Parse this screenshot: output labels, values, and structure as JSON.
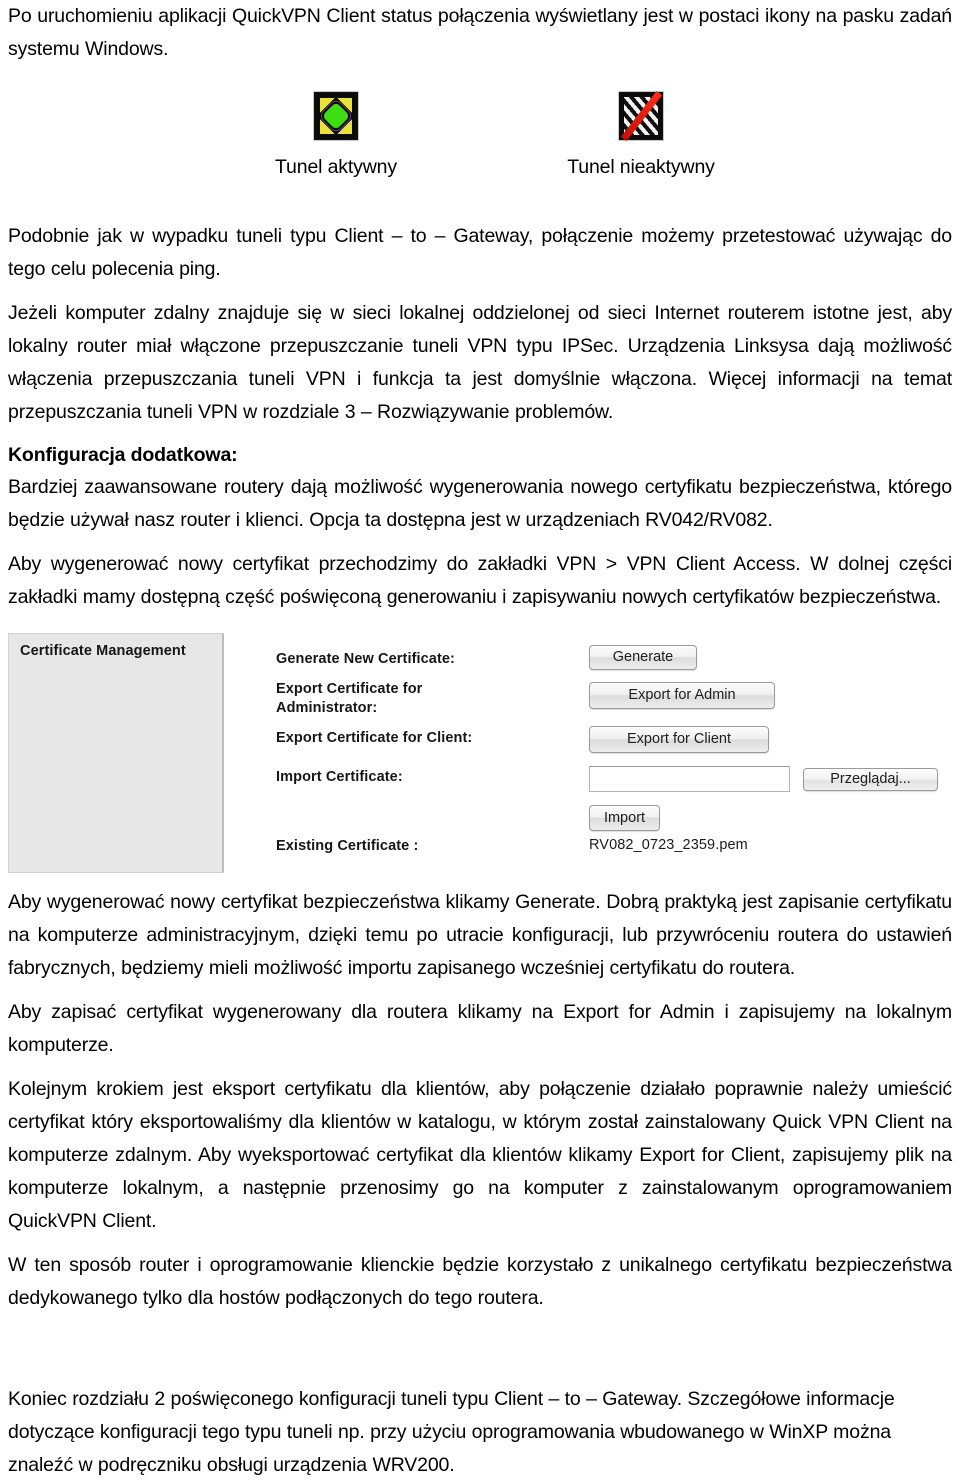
{
  "document": {
    "intro_paragraph": "Po uruchomieniu aplikacji QuickVPN Client status połączenia wyświetlany jest w postaci ikony na pasku zadań systemu Windows.",
    "tray_figure": {
      "active": {
        "icon": "tray-icon-tunnel-active",
        "caption": "Tunel aktywny"
      },
      "inactive": {
        "icon": "tray-icon-tunnel-inactive",
        "caption": "Tunel nieaktywny"
      }
    },
    "paragraph_ping": "Podobnie jak w wypadku tuneli typu Client – to – Gateway, połączenie możemy przetestować używając do tego celu polecenia ping.",
    "paragraph_ipsec": "Jeżeli komputer zdalny znajduje się w sieci lokalnej oddzielonej od sieci Internet routerem istotne jest, aby  lokalny router miał włączone przepuszczanie tuneli VPN typu IPSec. Urządzenia Linksysa dają możliwość włączenia przepuszczania tuneli VPN i funkcja ta jest domyślnie włączona. Więcej informacji na temat przepuszczania tuneli VPN w rozdziale 3 – Rozwiązywanie problemów.",
    "heading_extra_config": "Konfiguracja dodatkowa:",
    "paragraph_advanced": "Bardziej zaawansowane routery dają możliwość wygenerowania nowego certyfikatu bezpieczeństwa, którego będzie używał nasz router i klienci. Opcja ta dostępna jest w urządzeniach RV042/RV082.",
    "paragraph_vpn_tab": "Aby wygenerować nowy certyfikat przechodzimy do zakładki VPN > VPN Client Access. W dolnej części zakładki mamy dostępną część poświęconą generowaniu i zapisywaniu nowych certyfikatów bezpieczeństwa.",
    "paragraph_generate": "Aby wygenerować nowy certyfikat bezpieczeństwa klikamy Generate. Dobrą praktyką jest zapisanie certyfikatu na komputerze administracyjnym, dzięki temu po utracie konfiguracji, lub przywróceniu routera do ustawień fabrycznych, będziemy mieli możliwość importu zapisanego wcześniej certyfikatu do routera.",
    "paragraph_export_admin": "Aby zapisać certyfikat wygenerowany dla routera klikamy na Export for Admin i zapisujemy na lokalnym komputerze.",
    "paragraph_export_client": "Kolejnym krokiem jest eksport certyfikatu dla klientów, aby połączenie działało poprawnie należy umieścić certyfikat który eksportowaliśmy dla klientów w katalogu, w którym został zainstalowany Quick VPN Client na komputerze zdalnym. Aby wyeksportować certyfikat dla klientów klikamy Export for Client, zapisujemy plik na komputerze lokalnym, a następnie przenosimy go na komputer z zainstalowanym oprogramowaniem QuickVPN Client.",
    "paragraph_summary": "W ten sposób router i oprogramowanie klienckie będzie korzystało z unikalnego certyfikatu bezpieczeństwa dedykowanego tylko dla hostów podłączonych do tego routera.",
    "paragraph_chapter_end": "Koniec rozdziału 2 poświęconego konfiguracji tuneli typu Client – to – Gateway. Szczegółowe informacje dotyczące konfiguracji tego typu tuneli np. przy użyciu oprogramowania wbudowanego w WinXP można znaleźć w podręczniku obsługi urządzenia WRV200."
  },
  "certificate_screenshot": {
    "panel_title": "Certificate Management",
    "labels": {
      "generate_new": "Generate New Certificate:",
      "export_admin": "Export Certificate for\nAdministrator:",
      "export_client": "Export Certificate for Client:",
      "import": "Import Certificate:",
      "existing": "Existing Certificate :"
    },
    "buttons": {
      "generate": "Generate",
      "export_admin": "Export for Admin",
      "export_client": "Export for Client",
      "browse": "Przeglądaj...",
      "import": "Import"
    },
    "import_path_value": "",
    "import_path_placeholder": "",
    "existing_certificate_file": "RV082_0723_2359.pem"
  }
}
